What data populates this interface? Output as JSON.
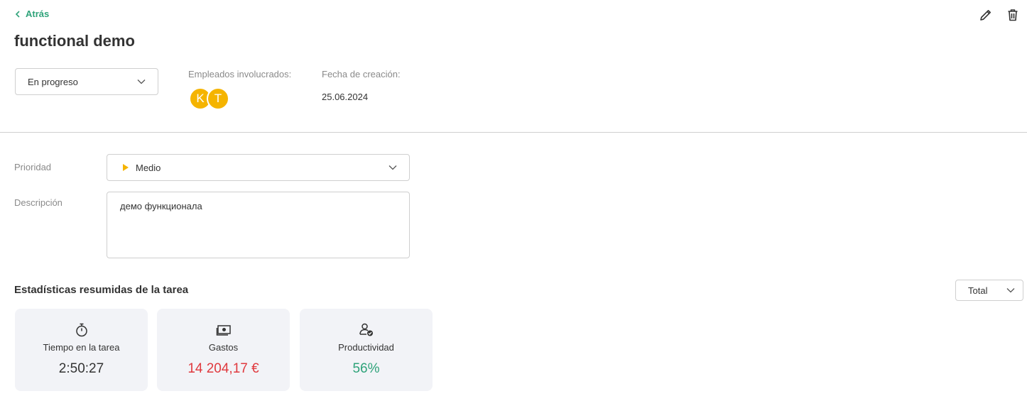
{
  "nav": {
    "back_label": "Atrás"
  },
  "task": {
    "title": "functional demo",
    "status": "En progreso",
    "employees_label": "Empleados involucrados:",
    "employees": [
      "K",
      "T"
    ],
    "created_label": "Fecha de creación:",
    "created_date": "25.06.2024"
  },
  "fields": {
    "priority_label": "Prioridad",
    "priority_value": "Medio",
    "description_label": "Descripción",
    "description_value": "демо функционала"
  },
  "stats": {
    "title": "Estadísticas resumidas de la tarea",
    "period": "Total",
    "cards": [
      {
        "icon": "stopwatch-icon",
        "label": "Tiempo en la tarea",
        "value": "2:50:27",
        "color": "#333333"
      },
      {
        "icon": "money-icon",
        "label": "Gastos",
        "value": "14 204,17 €",
        "color": "#e0393e"
      },
      {
        "icon": "user-check-icon",
        "label": "Productividad",
        "value": "56%",
        "color": "#2fa37a"
      }
    ]
  },
  "colors": {
    "accent": "#2fa37a",
    "avatar": "#f5b400",
    "priority_flag": "#f5b400"
  }
}
